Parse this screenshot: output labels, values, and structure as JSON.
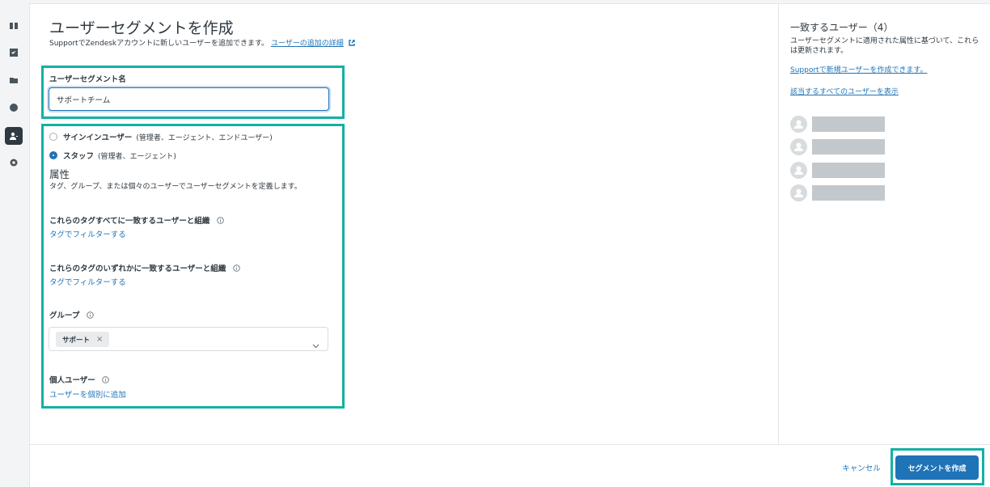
{
  "rail": {
    "icons": [
      "book-icon",
      "ticket-icon",
      "folder-icon",
      "palette-icon",
      "user-segment-icon",
      "gear-icon"
    ]
  },
  "form": {
    "title": "ユーザーセグメントを作成",
    "subtitle": "SupportでZendeskアカウントに新しいユーザーを追加できます。",
    "subtitle_link": "ユーザーの追加の詳細",
    "name_label": "ユーザーセグメント名",
    "name_value": "サポートチーム",
    "radios": [
      {
        "label": "サインインユーザー",
        "sub": "(管理者、エージェント、エンドユーザー)",
        "selected": false
      },
      {
        "label": "スタッフ",
        "sub": "(管理者、エージェント)",
        "selected": true
      }
    ],
    "attributes_title": "属性",
    "attributes_desc": "タグ、グループ、または個々のユーザーでユーザーセグメントを定義します。",
    "all_tags_label": "これらのタグすべてに一致するユーザーと組織",
    "all_tags_link": "タグでフィルターする",
    "any_tags_label": "これらのタグのいずれかに一致するユーザーと組織",
    "any_tags_link": "タグでフィルターする",
    "group_label": "グループ",
    "group_tag": "サポート",
    "group_tag_remove": "×",
    "individual_label": "個人ユーザー",
    "individual_link": "ユーザーを個別に追加"
  },
  "side": {
    "title": "一致するユーザー（4）",
    "desc": "ユーザーセグメントに適用された属性に基づいて、これらは更新されます。",
    "new_user_link": "Supportで新規ユーザーを作成できます。",
    "view_all_link": "該当するすべてのユーザーを表示",
    "user_count": 4
  },
  "footer": {
    "cancel_label": "キャンセル",
    "create_label": "セグメントを作成"
  },
  "colors": {
    "accent": "#1f73b7",
    "highlight": "#14b1a4"
  }
}
